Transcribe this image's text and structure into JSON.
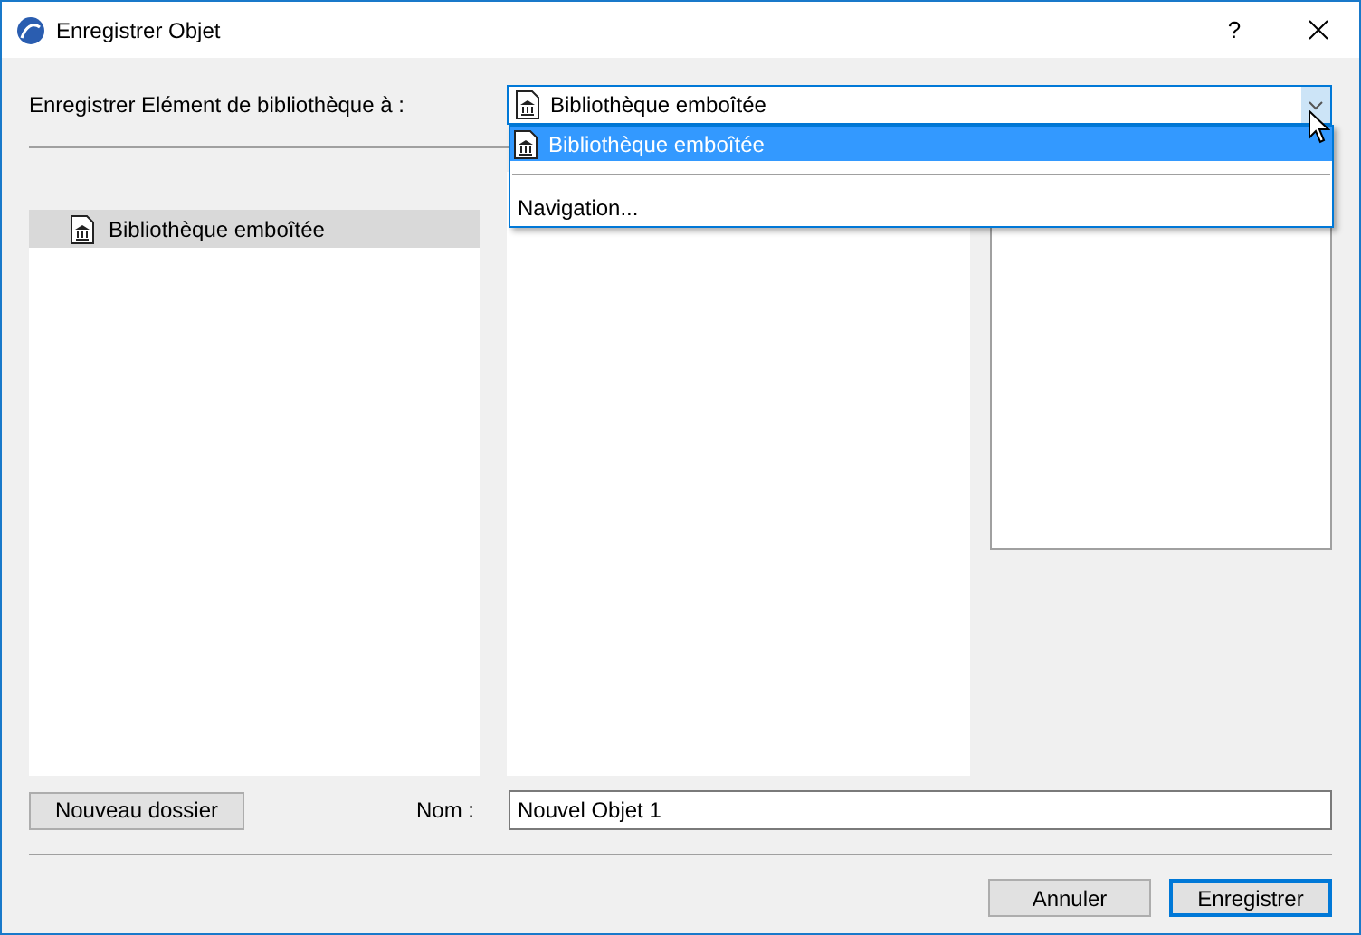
{
  "window": {
    "title": "Enregistrer Objet",
    "help": "?"
  },
  "destination": {
    "label": "Enregistrer Elément de bibliothèque à :",
    "value": "Bibliothèque emboîtée",
    "expanded": true,
    "options": [
      {
        "kind": "library",
        "label": "Bibliothèque emboîtée",
        "selected": true
      },
      {
        "kind": "separator"
      },
      {
        "kind": "plain",
        "label": "Navigation...",
        "selected": false
      }
    ]
  },
  "folders": [
    {
      "label": "Bibliothèque emboîtée",
      "selected": true
    }
  ],
  "new_folder_button": "Nouveau dossier",
  "name": {
    "label": "Nom :",
    "value": "Nouvel Objet 1"
  },
  "buttons": [
    {
      "label": "Annuler",
      "default": false
    },
    {
      "label": "Enregistrer",
      "default": true
    }
  ]
}
